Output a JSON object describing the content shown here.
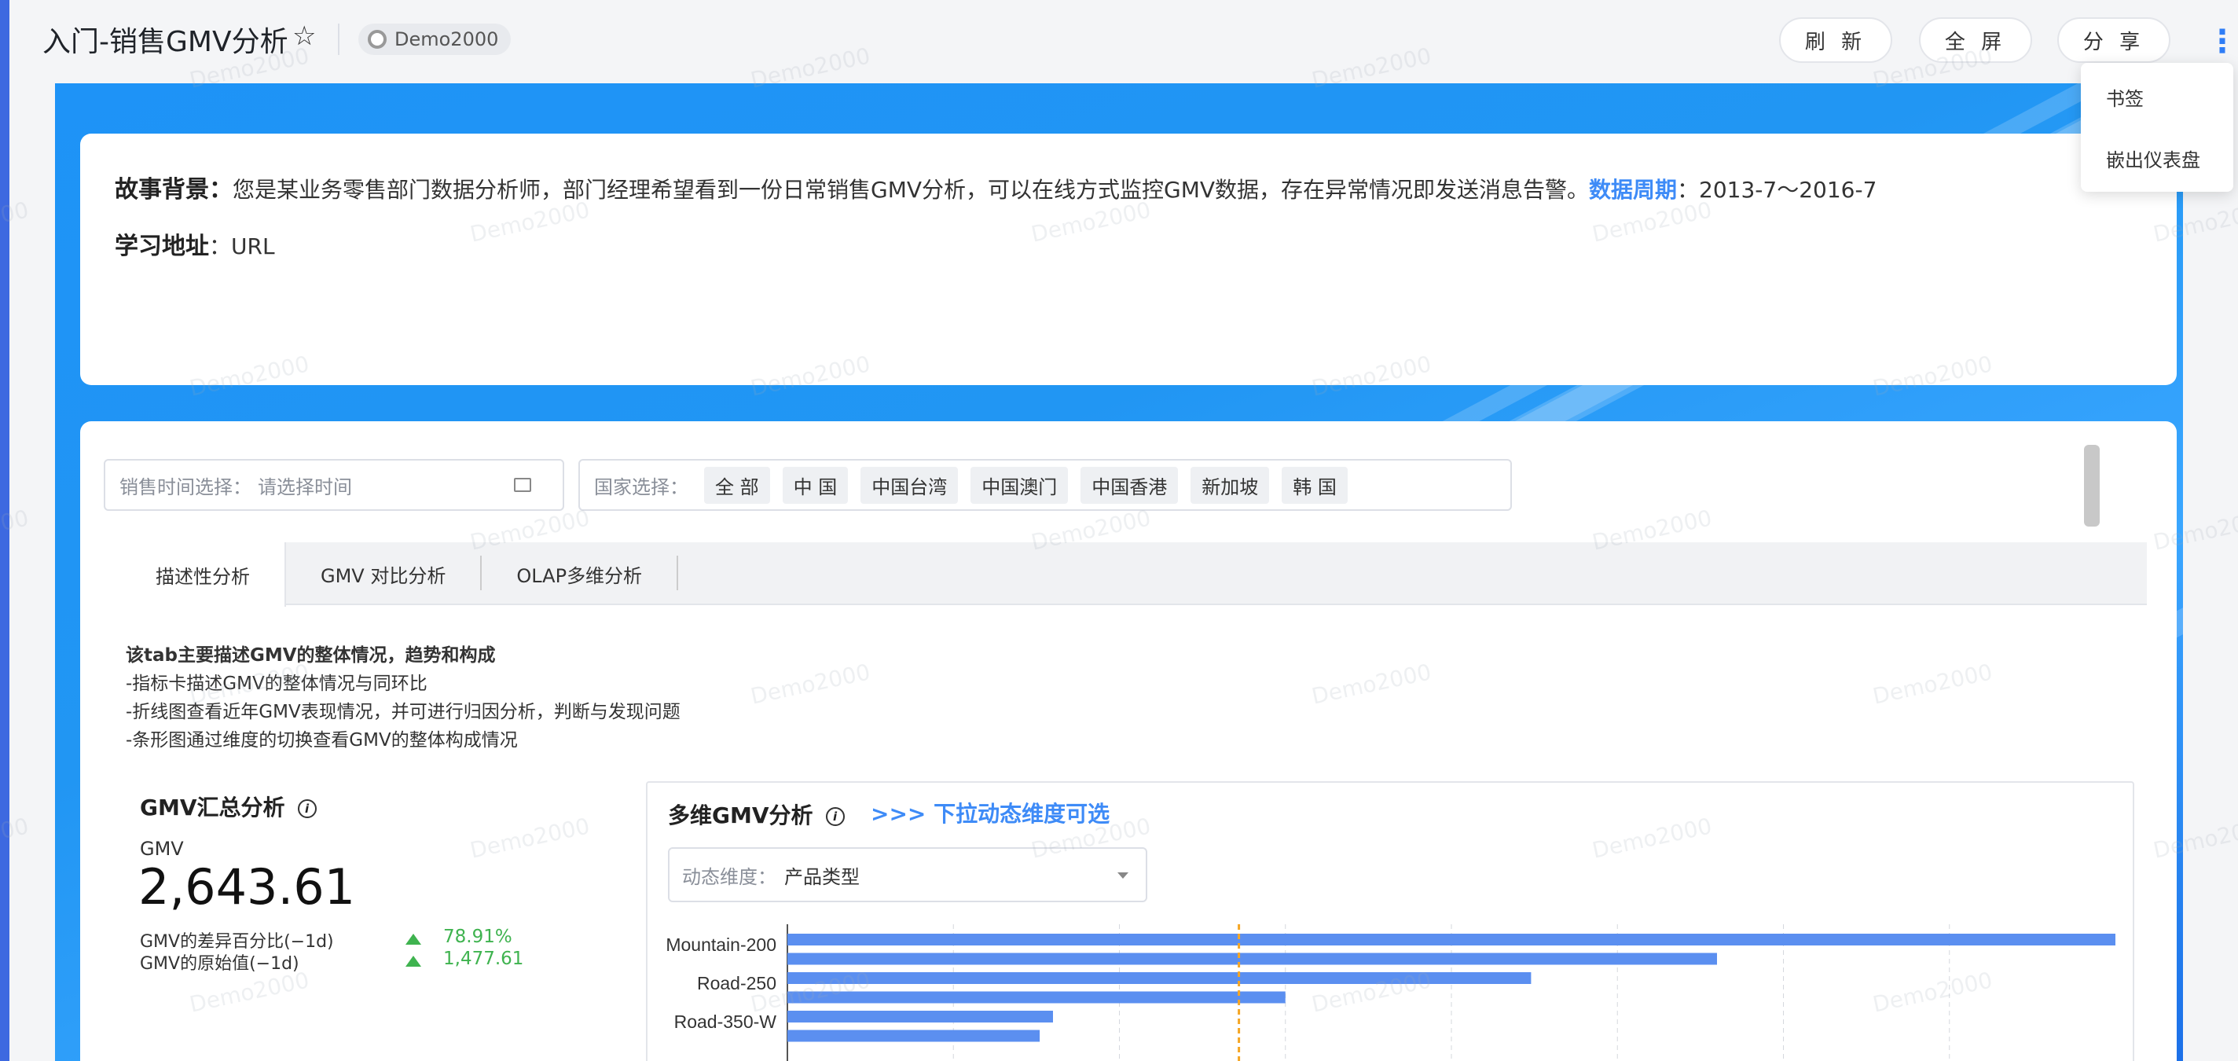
{
  "header": {
    "title": "入门-销售GMV分析",
    "user": "Demo2000",
    "buttons": {
      "refresh": "刷 新",
      "fullscreen": "全 屏",
      "share": "分 享"
    },
    "more": "⋮"
  },
  "menu": {
    "items": [
      "书签",
      "嵌出仪表盘"
    ]
  },
  "story": {
    "bg_label": "故事背景：",
    "bg_text": "您是某业务零售部门数据分析师，部门经理希望看到一份日常销售GMV分析，可以在线方式监控GMV数据，存在异常情况即发送消息告警。",
    "period_label": "数据周期",
    "period_value": "：2013-7～2016-7",
    "addr_label": "学习地址",
    "addr_value": "：URL"
  },
  "filters": {
    "time_label": "销售时间选择：",
    "time_placeholder": "请选择时间",
    "country_label": "国家选择：",
    "countries": [
      "全 部",
      "中 国",
      "中国台湾",
      "中国澳门",
      "中国香港",
      "新加坡",
      "韩 国"
    ]
  },
  "tabs": [
    "描述性分析",
    "GMV 对比分析",
    "OLAP多维分析"
  ],
  "description": {
    "heading": "该tab主要描述GMV的整体情况，趋势和构成",
    "lines": [
      "-指标卡描述GMV的整体情况与同环比",
      "-折线图查看近年GMV表现情况，并可进行归因分析，判断与发现问题",
      "-条形图通过维度的切换查看GMV的整体构成情况"
    ]
  },
  "gmv_card": {
    "title": "GMV汇总分析",
    "metric_label": "GMV",
    "metric_value": "2,643.61",
    "comparisons": [
      {
        "label": "GMV的差异百分比(−1d)",
        "value": "78.91%",
        "trend": "up"
      },
      {
        "label": "GMV的原始值(−1d)",
        "value": "1,477.61",
        "trend": "up"
      }
    ]
  },
  "multi": {
    "title": "多维GMV分析",
    "hint": ">>> 下拉动态维度可选",
    "dim_label": "动态维度：",
    "dim_value": "产品类型"
  },
  "watermark": "Demo2000",
  "colors": {
    "accent": "#3e8bf7",
    "bar": "#5b8ff0",
    "up": "#3fb34f",
    "refline": "#f5a623"
  },
  "chart_data": {
    "type": "bar",
    "orientation": "horizontal",
    "categories": [
      "Mountain-200",
      "",
      "Road-250",
      "",
      "Road-350-W",
      ""
    ],
    "values": [
      100,
      70,
      56,
      37.5,
      20,
      19
    ],
    "reference_line": 34,
    "grid": true
  }
}
